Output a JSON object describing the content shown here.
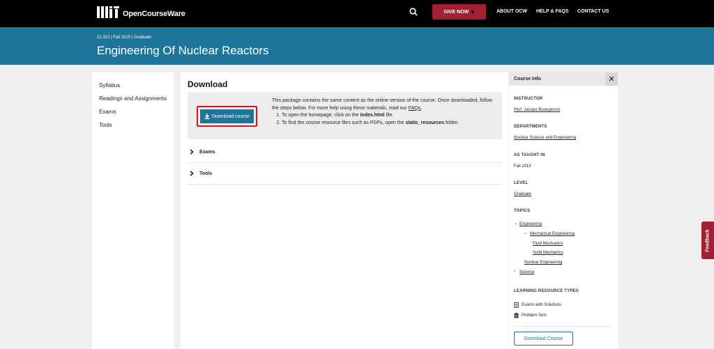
{
  "header": {
    "logo_text": "OpenCourseWare",
    "give_now": "GIVE NOW",
    "nav": [
      "ABOUT OCW",
      "HELP & FAQS",
      "CONTACT US"
    ]
  },
  "banner": {
    "meta": "22.312 | Fall 2015 | Graduate",
    "title": "Engineering Of Nuclear Reactors"
  },
  "left_nav": [
    "Syllabus",
    "Readings and Assignments",
    "Exams",
    "Tools"
  ],
  "main": {
    "heading": "Download",
    "download_button": "Download course",
    "intro": "This package contains the same content as the online version of the course. Once downloaded, follow the steps below. For more help using these materials, read our",
    "faqs_link": "FAQs",
    "step1_pre": "To open the homepage, click on the",
    "step1_file": "index.html",
    "step1_post": "file.",
    "step2_pre": "To find the course resource files such as PDFs, open the",
    "step2_folder": "static_resources",
    "step2_post": "folder.",
    "accordions": [
      "Exams",
      "Tools"
    ]
  },
  "course_info": {
    "title": "Course Info",
    "close": "✕",
    "instructor_label": "INSTRUCTOR",
    "instructor": "Prof. Jacopo Buongiorno",
    "departments_label": "DEPARTMENTS",
    "department": "Nuclear Science and Engineering",
    "taught_label": "AS TAUGHT IN",
    "taught": "Fall 2015",
    "level_label": "LEVEL",
    "level": "Graduate",
    "topics_label": "TOPICS",
    "topics": {
      "engineering": "Engineering",
      "mechanical": "Mechanical Engineering",
      "fluid": "Fluid Mechanics",
      "solid": "Solid Mechanics",
      "nuclear": "Nuclear Engineering",
      "science": "Science"
    },
    "lrt_label": "LEARNING RESOURCE TYPES",
    "lrt": [
      "Exams with Solutions",
      "Problem Sets"
    ],
    "download_button": "Download Course"
  },
  "feedback": "Feedback",
  "colors": {
    "mit_red": "#a31f34",
    "ocw_blue": "#1e7499",
    "highlight_red": "#e3101c"
  },
  "icons": [
    "mit-logo-icon",
    "search-icon",
    "heart-icon",
    "download-icon",
    "chevron-right-icon",
    "chevron-down-icon",
    "close-icon",
    "exam-icon",
    "problem-set-icon"
  ]
}
